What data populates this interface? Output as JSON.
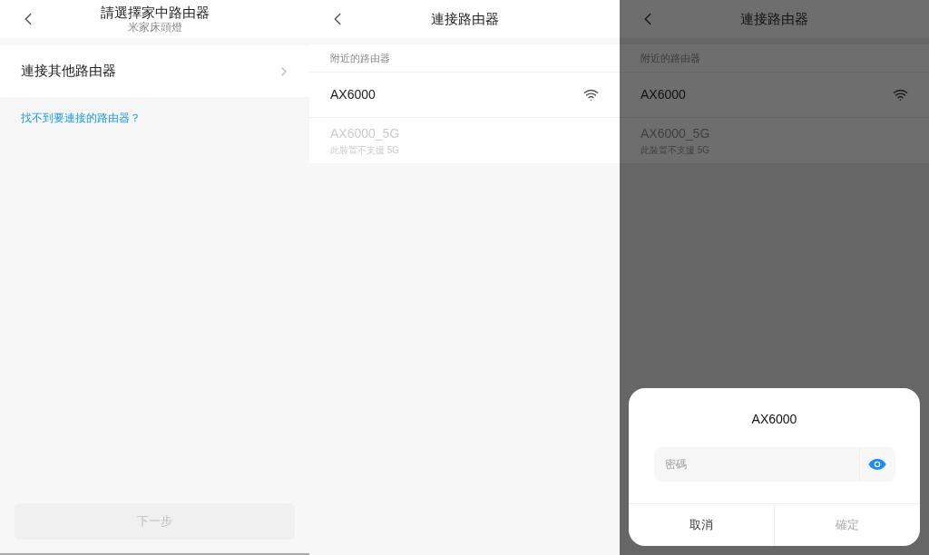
{
  "screens": [
    {
      "kind": "router_select",
      "dimmed": false,
      "title": "請選擇家中路由器",
      "subtitle": "米家床頭燈",
      "items": [
        {
          "label": "連接其他路由器"
        }
      ],
      "link": "找不到要連接的路由器？",
      "next_button": {
        "label": "下一步",
        "disabled": true
      }
    },
    {
      "kind": "router_list",
      "dimmed": false,
      "title": "連接路由器",
      "section": "附近的路由器",
      "networks": [
        {
          "name": "AX6000",
          "supported": true
        },
        {
          "name": "AX6000_5G",
          "note": "此裝置不支援 5G",
          "supported": false
        }
      ]
    },
    {
      "kind": "router_list",
      "dimmed": true,
      "title": "連接路由器",
      "section": "附近的路由器",
      "networks": [
        {
          "name": "AX6000",
          "supported": true
        },
        {
          "name": "AX6000_5G",
          "note": "此裝置不支援 5G",
          "supported": false
        }
      ],
      "dialog": {
        "title": "AX6000",
        "placeholder": "密碼",
        "buttons": [
          {
            "label": "取消",
            "disabled": false
          },
          {
            "label": "確定",
            "disabled": true
          }
        ]
      }
    }
  ]
}
